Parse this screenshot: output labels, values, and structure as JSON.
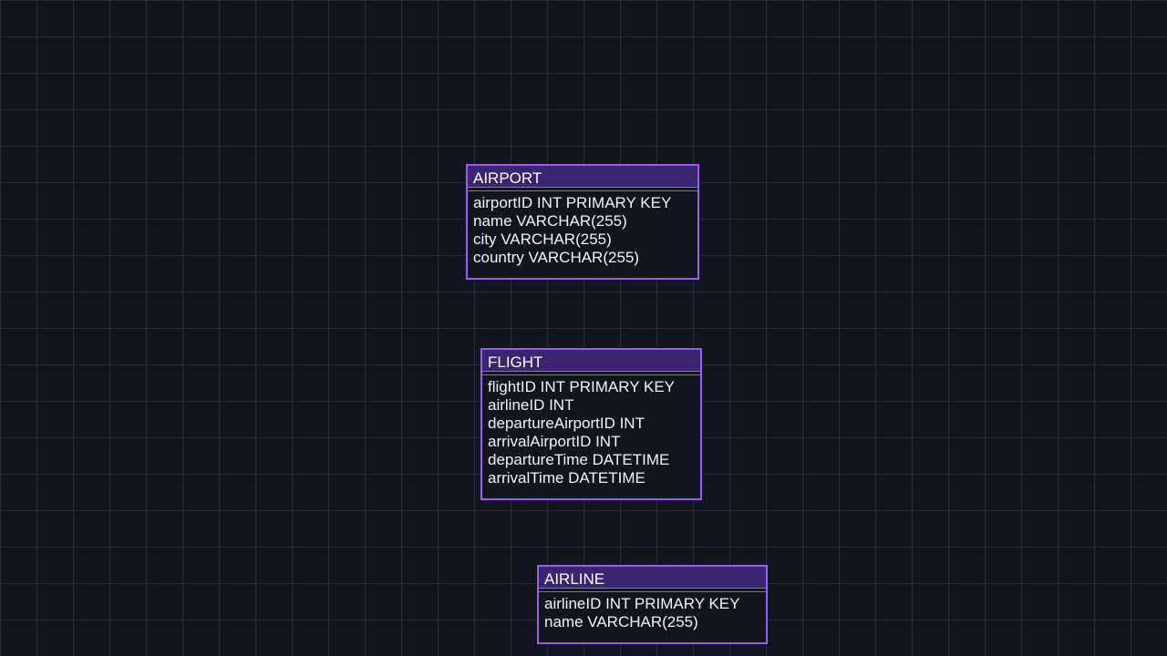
{
  "entities": [
    {
      "name": "AIRPORT",
      "fields": [
        "airportID INT PRIMARY KEY",
        "name VARCHAR(255)",
        "city VARCHAR(255)",
        "country VARCHAR(255)"
      ]
    },
    {
      "name": "FLIGHT",
      "fields": [
        "flightID INT PRIMARY KEY",
        "airlineID INT",
        "departureAirportID INT",
        "arrivalAirportID INT",
        "departureTime DATETIME",
        "arrivalTime DATETIME"
      ]
    },
    {
      "name": "AIRLINE",
      "fields": [
        "airlineID INT PRIMARY KEY",
        "name VARCHAR(255)"
      ]
    }
  ],
  "colors": {
    "background": "#12151e",
    "grid": "#262a35",
    "entity_border": "#9b5cf0",
    "entity_header": "#3b2470",
    "text": "#f2f2f2"
  }
}
